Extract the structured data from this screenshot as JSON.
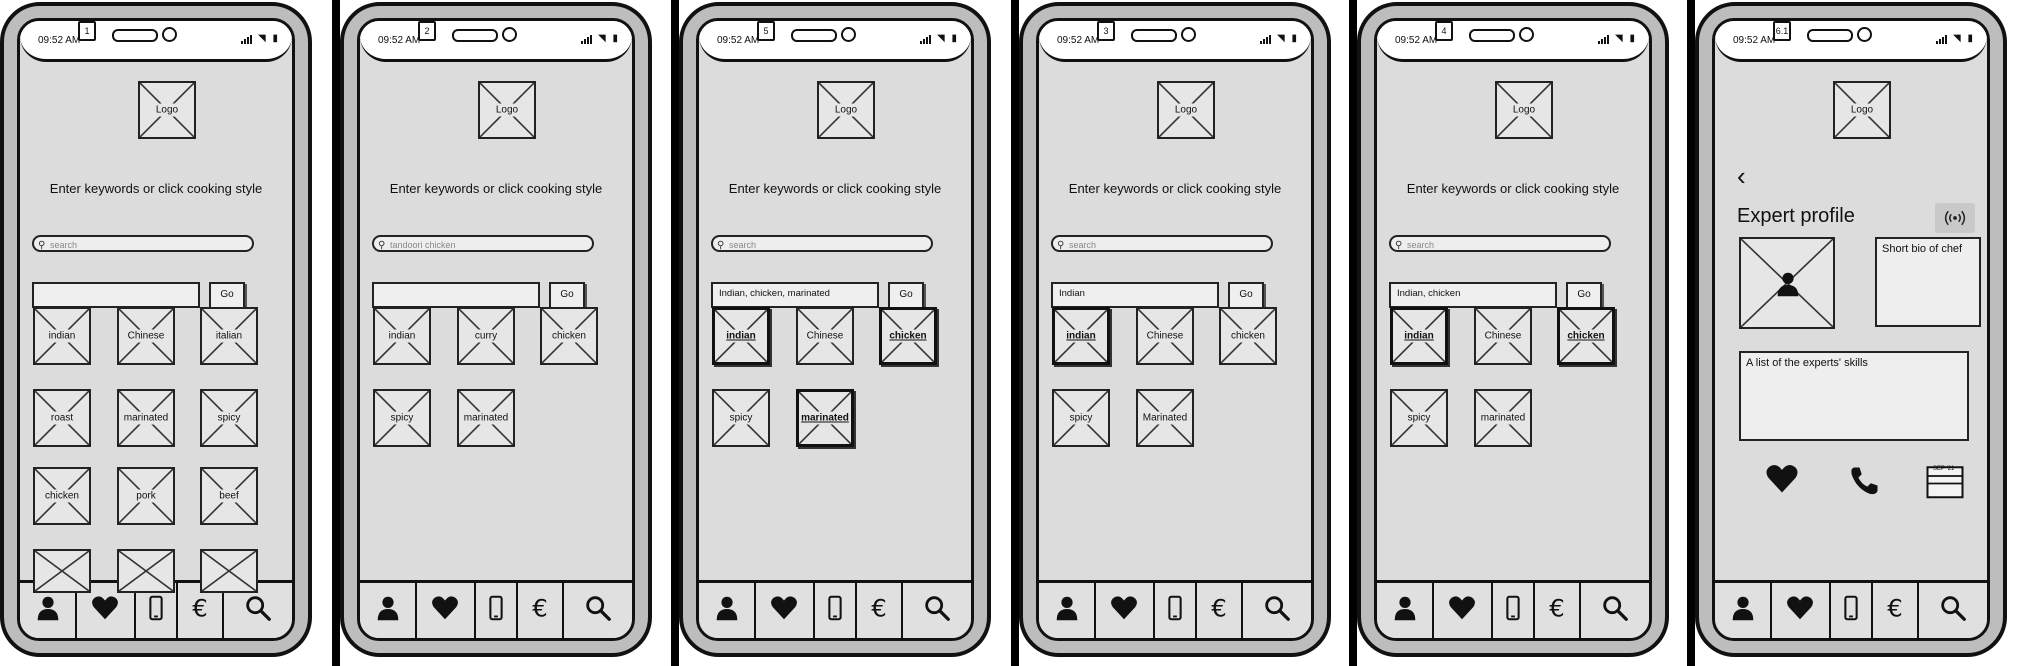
{
  "common": {
    "time": "09:52 AM",
    "prompt": "Enter keywords or click cooking style",
    "go_label": "Go",
    "logo_label": "Logo"
  },
  "screens": [
    {
      "number": "1",
      "search_value": "search",
      "keywords_value": "",
      "tiles": [
        {
          "label": "indian",
          "selected": false
        },
        {
          "label": "Chinese",
          "selected": false
        },
        {
          "label": "italian",
          "selected": false
        },
        {
          "label": "roast",
          "selected": false
        },
        {
          "label": "marinated",
          "selected": false
        },
        {
          "label": "spicy",
          "selected": false
        },
        {
          "label": "chicken",
          "selected": false
        },
        {
          "label": "pork",
          "selected": false
        },
        {
          "label": "beef",
          "selected": false
        },
        {
          "label": "",
          "selected": false
        },
        {
          "label": "",
          "selected": false
        },
        {
          "label": "",
          "selected": false
        }
      ]
    },
    {
      "number": "2",
      "search_value": "tandoori chicken",
      "keywords_value": "",
      "tiles": [
        {
          "label": "indian",
          "selected": false
        },
        {
          "label": "curry",
          "selected": false
        },
        {
          "label": "chicken",
          "selected": false
        },
        {
          "label": "spicy",
          "selected": false
        },
        {
          "label": "marinated",
          "selected": false
        }
      ]
    },
    {
      "number": "5",
      "search_value": "search",
      "keywords_value": "Indian, chicken, marinated",
      "tiles": [
        {
          "label": "indian",
          "selected": true
        },
        {
          "label": "Chinese",
          "selected": false
        },
        {
          "label": "chicken",
          "selected": true
        },
        {
          "label": "spicy",
          "selected": false
        },
        {
          "label": "marinated",
          "selected": true
        }
      ]
    },
    {
      "number": "3",
      "search_value": "search",
      "keywords_value": "Indian",
      "tiles": [
        {
          "label": "indian",
          "selected": true
        },
        {
          "label": "Chinese",
          "selected": false
        },
        {
          "label": "chicken",
          "selected": false
        },
        {
          "label": "spicy",
          "selected": false
        },
        {
          "label": "Marinated",
          "selected": false
        }
      ]
    },
    {
      "number": "4",
      "search_value": "search",
      "keywords_value": "Indian, chicken",
      "tiles": [
        {
          "label": "indian",
          "selected": true
        },
        {
          "label": "Chinese",
          "selected": false
        },
        {
          "label": "chicken",
          "selected": true
        },
        {
          "label": "spicy",
          "selected": false
        },
        {
          "label": "marinated",
          "selected": false
        }
      ]
    }
  ],
  "profile": {
    "number": "6.1",
    "back_icon": "chevron-left-icon",
    "title": "Expert profile",
    "bio": "Short bio of chef",
    "skills": "A list of the experts' skills",
    "calendar_label": "SEP '21",
    "actions": [
      "heart-icon",
      "phone-icon",
      "calendar-icon"
    ]
  },
  "tabbar": {
    "icons": [
      "user-icon",
      "heart-icon",
      "mobile-icon",
      "euro-icon",
      "search-icon"
    ]
  },
  "colors": {
    "screen_bg": "#dcdcdc",
    "frame": "#111111",
    "phone_body": "#bdbdbd"
  }
}
